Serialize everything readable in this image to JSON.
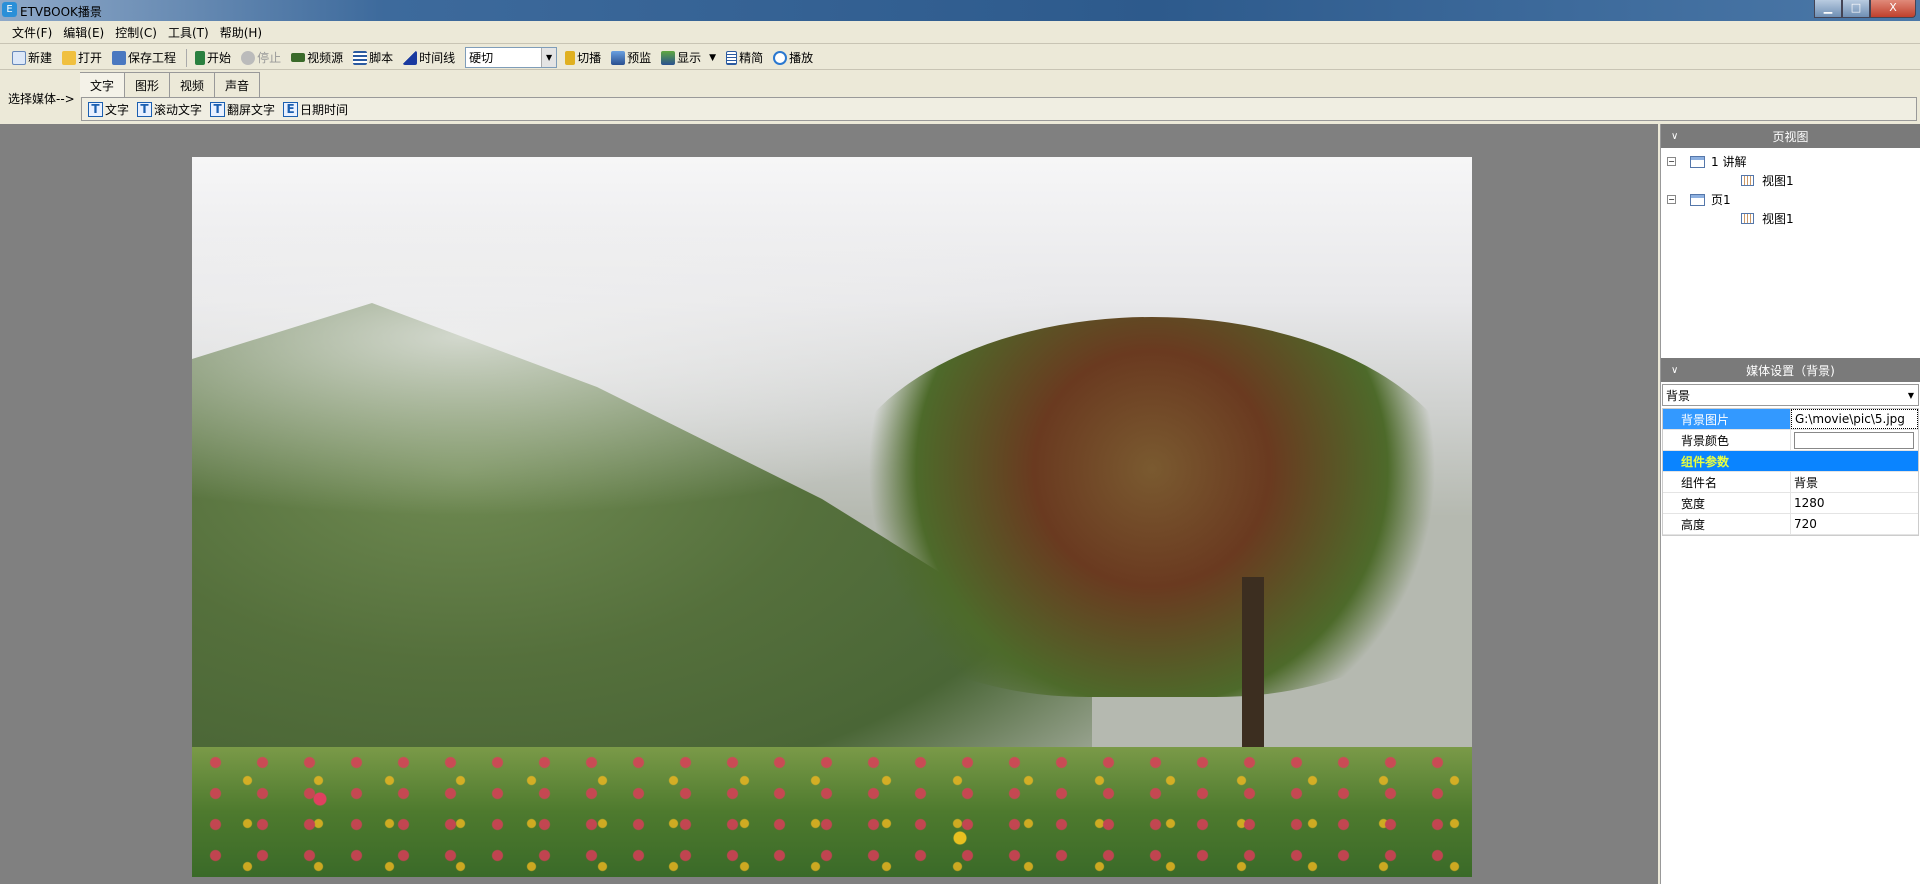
{
  "window": {
    "title": "ETVBOOK播景",
    "min": "▁",
    "max": "□",
    "close": "X",
    "app_icon": "E"
  },
  "menu": [
    "文件(F)",
    "编辑(E)",
    "控制(C)",
    "工具(T)",
    "帮助(H)"
  ],
  "toolbar": {
    "new": "新建",
    "open": "打开",
    "save": "保存工程",
    "start": "开始",
    "stop": "停止",
    "video_source": "视频源",
    "script": "脚本",
    "timeline": "时间线",
    "transition": "硬切",
    "cut": "切播",
    "preview": "预监",
    "display": "显示",
    "simple": "精简",
    "play": "播放"
  },
  "media": {
    "label": "选择媒体-->",
    "tabs": [
      "文字",
      "图形",
      "视频",
      "声音"
    ],
    "items": [
      "文字",
      "滚动文字",
      "翻屏文字",
      "日期时间"
    ],
    "item_icons": [
      "T",
      "T",
      "T",
      "E"
    ]
  },
  "page_view": {
    "title": "页视图",
    "nodes": [
      {
        "label": "1 讲解",
        "child": "视图1"
      },
      {
        "label": "页1",
        "child": "视图1"
      }
    ]
  },
  "media_settings": {
    "title": "媒体设置（背景)",
    "selected": "背景",
    "rows": [
      {
        "key": "背景图片",
        "value": "G:\\movie\\pic\\5.jpg"
      },
      {
        "key": "背景颜色",
        "value": ""
      }
    ],
    "category": "组件参数",
    "params": [
      {
        "key": "组件名",
        "value": "背景"
      },
      {
        "key": "宽度",
        "value": "1280"
      },
      {
        "key": "高度",
        "value": "720"
      }
    ]
  }
}
